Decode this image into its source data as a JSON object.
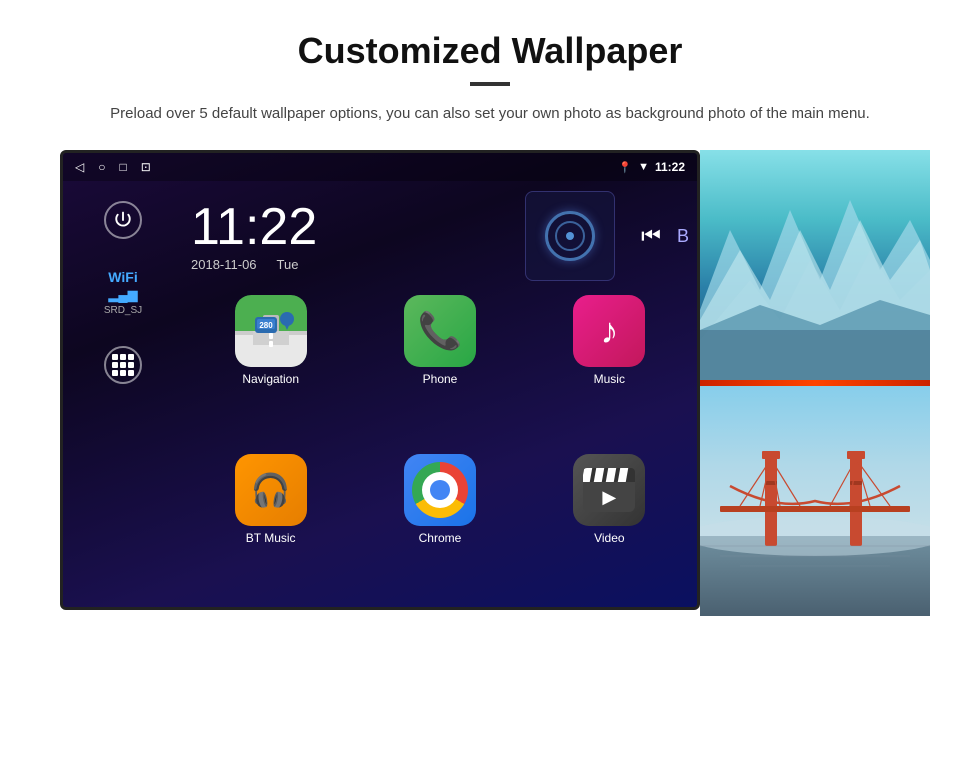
{
  "header": {
    "title": "Customized Wallpaper",
    "description": "Preload over 5 default wallpaper options, you can also set your own photo as background photo of the main menu."
  },
  "statusBar": {
    "time": "11:22",
    "navIcons": [
      "◁",
      "○",
      "□",
      "⊡"
    ],
    "statusIcons": [
      "📍",
      "▼"
    ]
  },
  "clock": {
    "time": "11:22",
    "date": "2018-11-06",
    "day": "Tue"
  },
  "sidebar": {
    "wifiLabel": "WiFi",
    "wifiSSID": "SRD_SJ"
  },
  "apps": [
    {
      "name": "Navigation",
      "type": "nav"
    },
    {
      "name": "Phone",
      "type": "phone"
    },
    {
      "name": "Music",
      "type": "music"
    },
    {
      "name": "BT Music",
      "type": "bt"
    },
    {
      "name": "Chrome",
      "type": "chrome"
    },
    {
      "name": "Video",
      "type": "video"
    }
  ],
  "wallpapers": {
    "labels": [
      "ice",
      "bridge"
    ]
  }
}
